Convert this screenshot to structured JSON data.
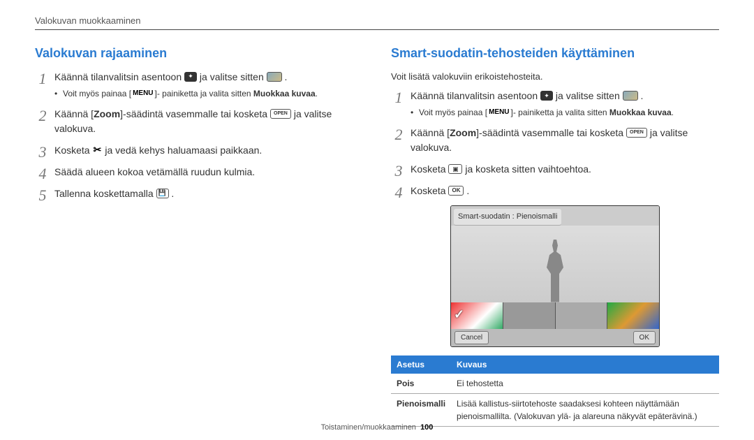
{
  "breadcrumb": "Valokuvan muokkaaminen",
  "footer": {
    "section": "Toistaminen/muokkaaminen",
    "page": "100"
  },
  "left": {
    "heading": "Valokuvan rajaaminen",
    "steps": [
      {
        "num": "1",
        "pre": "Käännä tilanvalitsin asentoon ",
        "mid": " ja valitse sitten ",
        "post": ".",
        "sub_pre": "Voit myös painaa [",
        "sub_menu": "MENU",
        "sub_mid": "]- painiketta ja valita sitten ",
        "sub_bold": "Muokkaa kuvaa",
        "sub_post": "."
      },
      {
        "num": "2",
        "pre": "Käännä [",
        "zoom": "Zoom",
        "mid": "]-säädintä vasemmalle tai kosketa ",
        "open": "OPEN",
        "post": " ja valitse valokuva."
      },
      {
        "num": "3",
        "pre": "Kosketa ",
        "post": " ja vedä kehys haluamaasi paikkaan."
      },
      {
        "num": "4",
        "text": "Säädä alueen kokoa vetämällä ruudun kulmia."
      },
      {
        "num": "5",
        "pre": "Tallenna koskettamalla ",
        "post": "."
      }
    ]
  },
  "right": {
    "heading": "Smart-suodatin-tehosteiden käyttäminen",
    "intro": "Voit lisätä valokuviin erikoistehosteita.",
    "steps": [
      {
        "num": "1",
        "pre": "Käännä tilanvalitsin asentoon ",
        "mid": " ja valitse sitten ",
        "post": ".",
        "sub_pre": "Voit myös painaa [",
        "sub_menu": "MENU",
        "sub_mid": "]- painiketta ja valita sitten ",
        "sub_bold": "Muokkaa kuvaa",
        "sub_post": "."
      },
      {
        "num": "2",
        "pre": "Käännä [",
        "zoom": "Zoom",
        "mid": "]-säädintä vasemmalle tai kosketa ",
        "open": "OPEN",
        "post": " ja valitse valokuva."
      },
      {
        "num": "3",
        "pre": "Kosketa ",
        "post": " ja kosketa sitten vaihtoehtoa."
      },
      {
        "num": "4",
        "pre": "Kosketa ",
        "ok": "OK",
        "post": "."
      }
    ],
    "screen": {
      "title": "Smart-suodatin : Pienoismalli",
      "cancel": "Cancel",
      "ok": "OK"
    },
    "table": {
      "headers": [
        "Asetus",
        "Kuvaus"
      ],
      "rows": [
        {
          "name": "Pois",
          "desc": "Ei tehostetta"
        },
        {
          "name": "Pienoismalli",
          "desc": "Lisää kallistus-siirtotehoste saadaksesi kohteen näyttämään pienoismallilta. (Valokuvan ylä- ja alareuna näkyvät epäterävinä.)"
        }
      ]
    }
  }
}
